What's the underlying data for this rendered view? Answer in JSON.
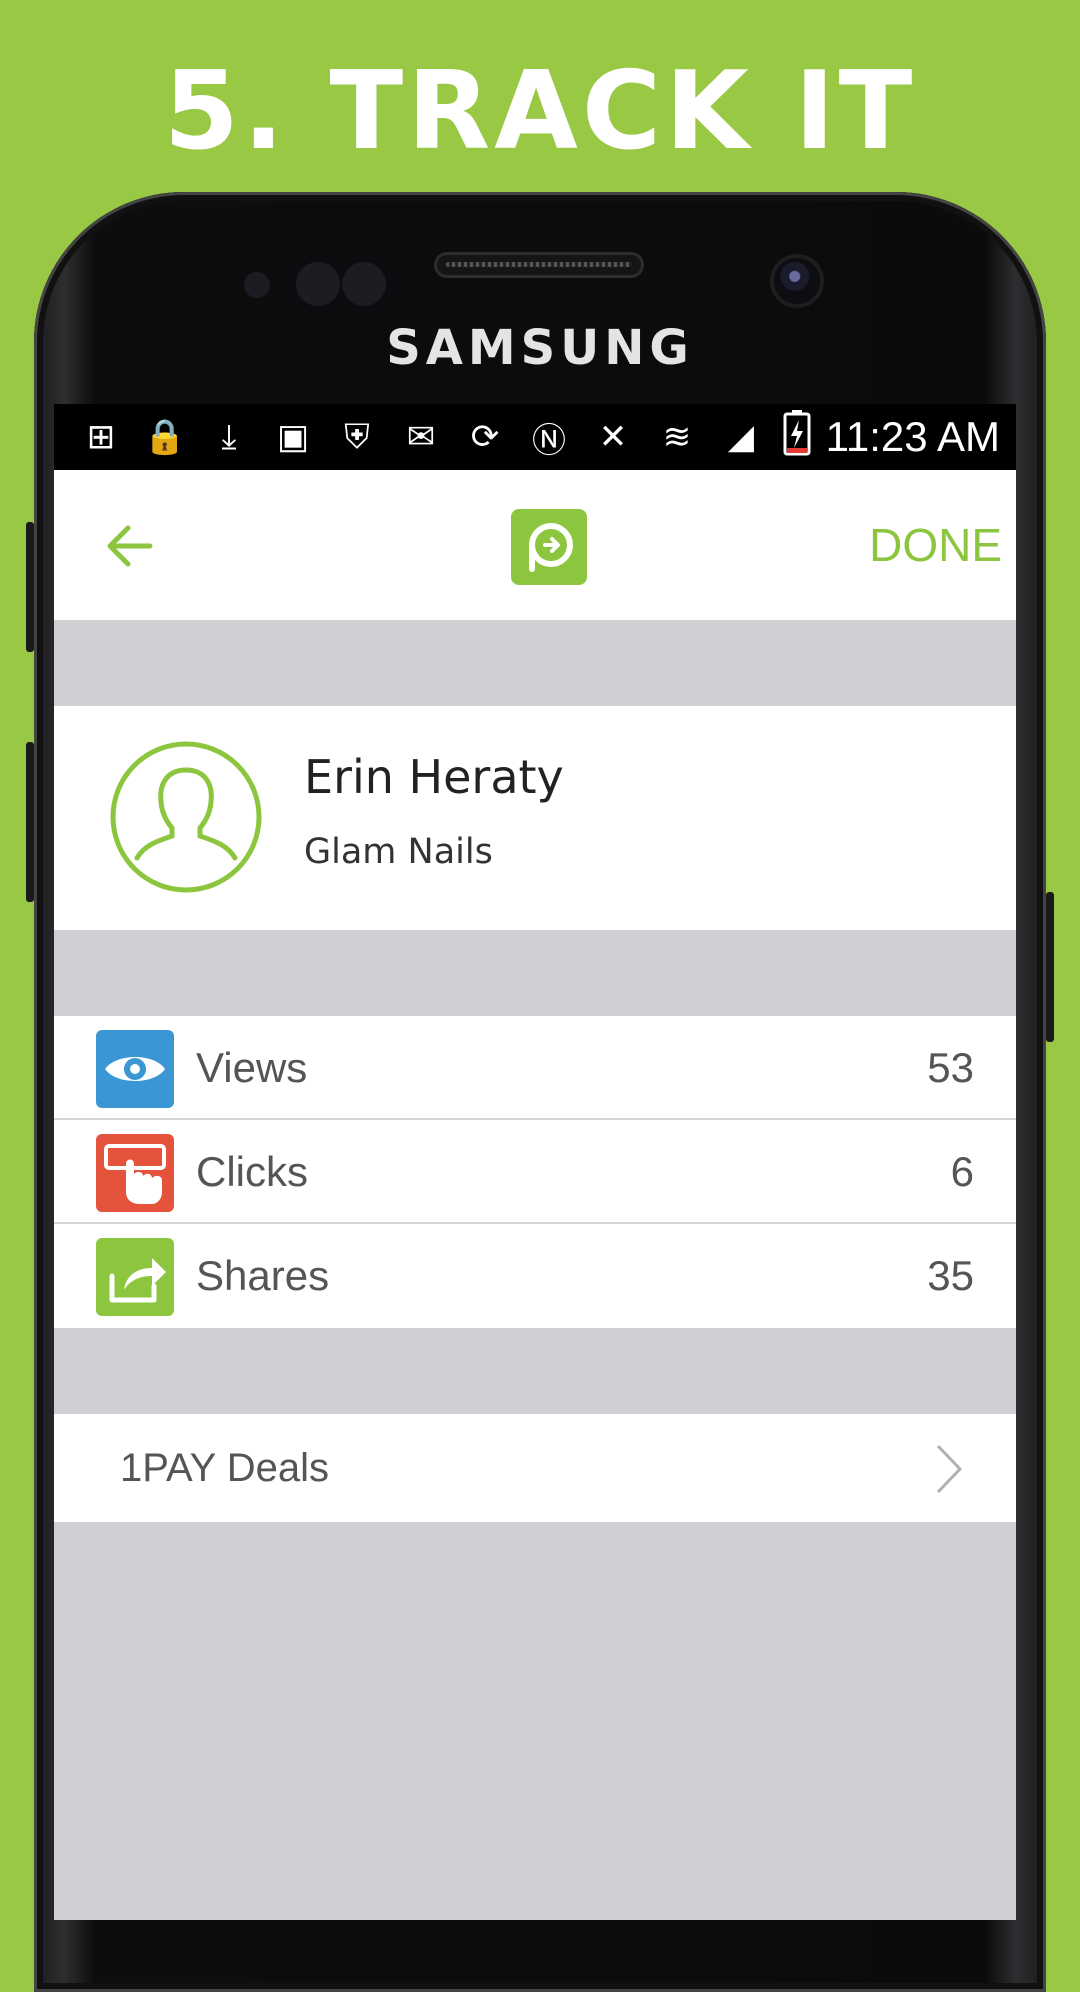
{
  "headline": "5. TRACK IT",
  "device": {
    "brand": "SAMSUNG"
  },
  "statusbar": {
    "icons": [
      "add-box-icon",
      "lock-alert-icon",
      "download-icon",
      "image-icon",
      "shield-icon",
      "gmail-icon",
      "sync-icon",
      "nfc-icon",
      "mute-icon",
      "wifi-icon",
      "signal-icon",
      "battery-charging-icon"
    ],
    "time": "11:23 AM"
  },
  "appbar": {
    "back_icon": "arrow-left-icon",
    "logo_icon": "app-logo-icon",
    "done_label": "DONE"
  },
  "profile": {
    "name": "Erin Heraty",
    "company": "Glam Nails",
    "avatar_icon": "user-avatar-icon"
  },
  "stats": [
    {
      "label": "Views",
      "value": "53",
      "icon": "eye-icon",
      "color": "#3b97d3"
    },
    {
      "label": "Clicks",
      "value": "6",
      "icon": "tap-icon",
      "color": "#e5533d"
    },
    {
      "label": "Shares",
      "value": "35",
      "icon": "share-icon",
      "color": "#8cc63f"
    }
  ],
  "deals": {
    "label": "1PAY Deals",
    "chevron_icon": "chevron-right-icon"
  },
  "colors": {
    "background": "#99c845",
    "accent": "#8cc63f",
    "panel": "#d0d0d4"
  }
}
